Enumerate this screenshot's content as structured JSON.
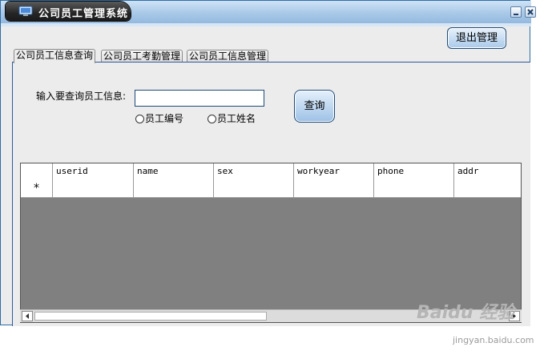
{
  "window": {
    "title": "公司员工管理系统",
    "minimize_icon": "minimize-icon",
    "close_icon": "close-icon"
  },
  "toolbar": {
    "exit_label": "退出管理"
  },
  "tabs": [
    {
      "label": "公司员工信息查询",
      "active": true
    },
    {
      "label": "公司员工考勤管理",
      "active": false
    },
    {
      "label": "公司员工信息管理",
      "active": false
    }
  ],
  "search": {
    "label": "输入要查询员工信息:",
    "value": "",
    "placeholder": "",
    "options": [
      {
        "label": "员工编号",
        "selected": false
      },
      {
        "label": "员工姓名",
        "selected": false
      }
    ],
    "query_label": "查询"
  },
  "grid": {
    "columns": [
      "userid",
      "name",
      "sex",
      "workyear",
      "phone",
      "addr"
    ],
    "new_row_marker": "*",
    "rows": []
  },
  "watermark": {
    "brand": "Baidu 经验",
    "url": "jingyan.baidu.com"
  },
  "colors": {
    "accent": "#2e6da4",
    "grid_empty": "#808080"
  }
}
